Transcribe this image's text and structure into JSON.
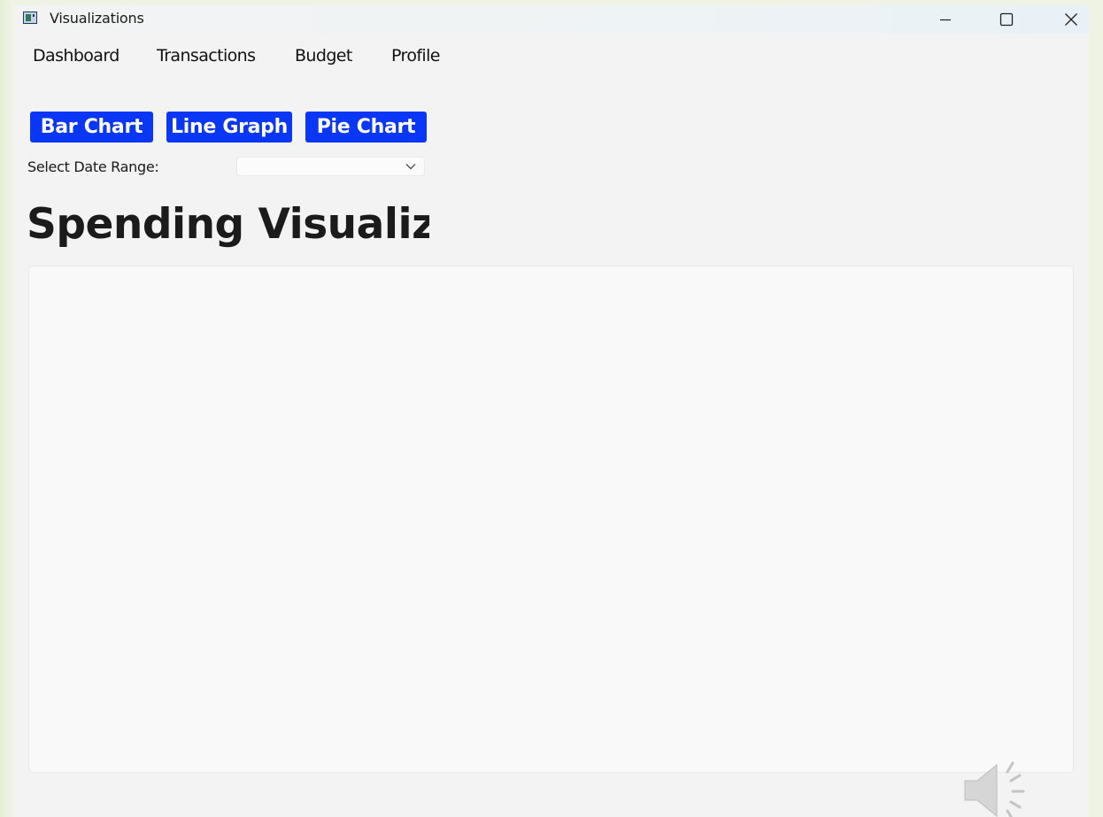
{
  "window": {
    "title": "Visualizations",
    "app_icon": "app-window-icon",
    "controls": [
      "minimize-icon",
      "maximize-icon",
      "close-icon"
    ]
  },
  "menu": {
    "items": [
      {
        "label": "Dashboard"
      },
      {
        "label": "Transactions"
      },
      {
        "label": "Budget"
      },
      {
        "label": "Profile"
      }
    ]
  },
  "toolbar": {
    "buttons": [
      {
        "label": "Bar Chart"
      },
      {
        "label": "Line Graph"
      },
      {
        "label": "Pie Chart"
      }
    ],
    "button_color": "#0a37f5"
  },
  "filters": {
    "date_range_label": "Select Date Range:",
    "date_range_value": ""
  },
  "main": {
    "heading": "Spending Visualiza"
  },
  "overlay": {
    "icon": "speaker-icon"
  }
}
